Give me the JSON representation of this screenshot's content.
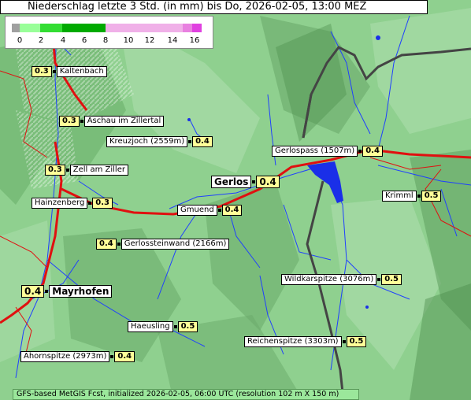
{
  "title": "Niederschlag letzte 3 Std. (in mm) bis Do, 2026-02-05, 13:00 MEZ",
  "legend": {
    "ticks": [
      "0",
      "2",
      "4",
      "6",
      "8",
      "10",
      "12",
      "14",
      "16"
    ],
    "colors": {
      "gray": "#a0a0a0",
      "green_light": "#99ff99",
      "green_mid": "#33cc33",
      "green_dark": "#00aa00",
      "pink": "#f0b0e8",
      "magenta": "#e040e0"
    }
  },
  "locations": [
    {
      "id": "kaltenbach",
      "value": "0.3",
      "name": "Kaltenbach"
    },
    {
      "id": "aschau",
      "value": "0.3",
      "name": "Aschau im Zillertal"
    },
    {
      "id": "kreuzjoch",
      "value": "0.4",
      "name": "Kreuzjoch (2559m)"
    },
    {
      "id": "gerlospass",
      "value": "0.4",
      "name": "Gerlospass (1507m)"
    },
    {
      "id": "zell",
      "value": "0.3",
      "name": "Zell am Ziller"
    },
    {
      "id": "gerlos",
      "value": "0.4",
      "name": "Gerlos"
    },
    {
      "id": "krimml",
      "value": "0.5",
      "name": "Krimml"
    },
    {
      "id": "hainzenberg",
      "value": "0.3",
      "name": "Hainzenberg"
    },
    {
      "id": "gmuend",
      "value": "0.4",
      "name": "Gmuend"
    },
    {
      "id": "gerlossteinwand",
      "value": "0.4",
      "name": "Gerlossteinwand (2166m)"
    },
    {
      "id": "wildkarspitze",
      "value": "0.5",
      "name": "Wildkarspitze (3076m)"
    },
    {
      "id": "mayrhofen",
      "value": "0.4",
      "name": "Mayrhofen"
    },
    {
      "id": "haeusling",
      "value": "0.5",
      "name": "Haeusling"
    },
    {
      "id": "reichenspitze",
      "value": "0.5",
      "name": "Reichenspitze (3303m)"
    },
    {
      "id": "ahornspitze",
      "value": "0.4",
      "name": "Ahornspitze (2973m)"
    }
  ],
  "footer": "GFS-based MetGIS Fcst, initialized 2026-02-05, 06:00 UTC  (resolution 102 m X 150 m)",
  "colors": {
    "terrain": "#8fd08f",
    "river": "#1f3fff",
    "road": "#e01010",
    "border": "#444444",
    "lake": "#1a2fe8",
    "value_box": "#ffff99"
  }
}
